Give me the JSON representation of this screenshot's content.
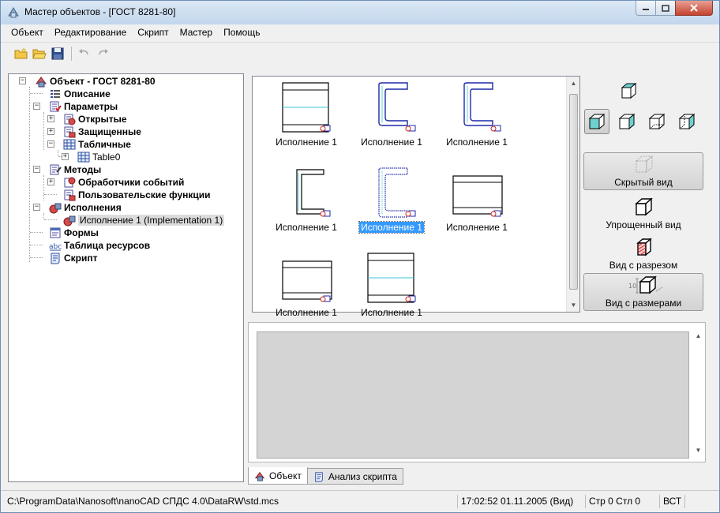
{
  "window": {
    "title": "Мастер объектов - [ГОСТ 8281-80]"
  },
  "menu": [
    "Объект",
    "Редактирование",
    "Скрипт",
    "Мастер",
    "Помощь"
  ],
  "toolbar": {
    "icons": [
      "new-folder-icon",
      "open-folder-icon",
      "save-icon",
      "undo-icon",
      "redo-icon"
    ]
  },
  "tree": [
    {
      "label": "Объект - ГОСТ 8281-80",
      "bold": true,
      "icon": "object-icon"
    },
    {
      "label": "Описание",
      "bold": true,
      "icon": "list-icon"
    },
    {
      "label": "Параметры",
      "bold": true,
      "icon": "parameters-icon"
    },
    {
      "label": "Открытые",
      "bold": true,
      "icon": "open-params-icon"
    },
    {
      "label": "Защищенные",
      "bold": true,
      "icon": "protected-params-icon"
    },
    {
      "label": "Табличные",
      "bold": true,
      "icon": "table-icon"
    },
    {
      "label": "Table0",
      "bold": false,
      "icon": "table-icon"
    },
    {
      "label": "Методы",
      "bold": true,
      "icon": "methods-icon"
    },
    {
      "label": "Обработчики событий",
      "bold": true,
      "icon": "event-handlers-icon"
    },
    {
      "label": "Пользовательские функции",
      "bold": true,
      "icon": "user-functions-icon"
    },
    {
      "label": "Исполнения",
      "bold": true,
      "icon": "implementations-icon"
    },
    {
      "label": "Исполнение 1 (Implementation 1)",
      "bold": false,
      "icon": "implementation-icon"
    },
    {
      "label": "Формы",
      "bold": true,
      "icon": "forms-icon"
    },
    {
      "label": "Таблица ресурсов",
      "bold": true,
      "icon": "resources-icon"
    },
    {
      "label": "Скрипт",
      "bold": true,
      "icon": "script-icon"
    }
  ],
  "gallery": {
    "items": [
      {
        "caption": "Исполнение 1",
        "shape": "rect-cyan",
        "selected": false
      },
      {
        "caption": "Исполнение 1",
        "shape": "channel-blue",
        "selected": false
      },
      {
        "caption": "Исполнение 1",
        "shape": "channel-blue",
        "selected": false
      },
      {
        "caption": "Исполнение 1",
        "shape": "channel-black",
        "selected": false
      },
      {
        "caption": "Исполнение 1",
        "shape": "channel-dotted",
        "selected": true
      },
      {
        "caption": "Исполнение 1",
        "shape": "rect-lines",
        "selected": false
      },
      {
        "caption": "Исполнение 1",
        "shape": "rect-lines",
        "selected": false
      },
      {
        "caption": "Исполнение 1",
        "shape": "rect-cyan",
        "selected": false
      }
    ]
  },
  "views": {
    "buttons": [
      {
        "label": "Скрытый вид",
        "icon": "hidden-view-icon",
        "pressed": true
      },
      {
        "label": "Упрощенный вид",
        "icon": "simplified-view-icon",
        "pressed": false
      },
      {
        "label": "Вид с разрезом",
        "icon": "section-view-icon",
        "pressed": false
      },
      {
        "label": "Вид с размерами",
        "icon": "dimensions-view-icon",
        "pressed": true
      }
    ],
    "dimension_mark": "10"
  },
  "tabs": [
    {
      "label": "Объект",
      "active": true,
      "icon": "object-icon"
    },
    {
      "label": "Анализ скрипта",
      "active": false,
      "icon": "script-analysis-icon"
    }
  ],
  "status": {
    "path": "C:\\ProgramData\\Nanosoft\\nanoCAD СПДС 4.0\\DataRW\\std.mcs",
    "datetime": "17:02:52  01.11.2005 (Вид)",
    "position": "Стр 0 Стл 0",
    "mode": "ВСТ"
  }
}
